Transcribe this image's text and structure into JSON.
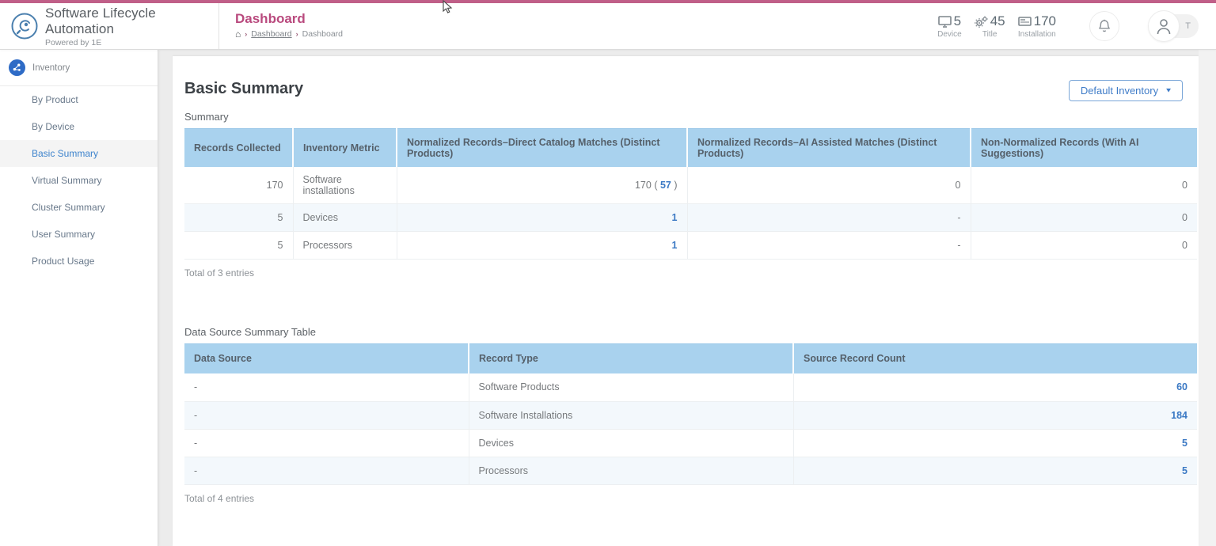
{
  "app": {
    "title": "Software Lifecycle Automation",
    "subtitle": "Powered by 1E"
  },
  "header": {
    "page_title": "Dashboard",
    "breadcrumb": {
      "home": "⌂",
      "crumb1": "Dashboard",
      "crumb2": "Dashboard"
    },
    "stats": [
      {
        "icon": "monitor-icon",
        "value": "5",
        "label": "Device"
      },
      {
        "icon": "gears-icon",
        "value": "45",
        "label": "Title"
      },
      {
        "icon": "installation-icon",
        "value": "170",
        "label": "Installation"
      }
    ],
    "avatar_badge": "T"
  },
  "sidebar": {
    "section_label": "Inventory",
    "items": [
      {
        "label": "By Product"
      },
      {
        "label": "By Device"
      },
      {
        "label": "Basic Summary"
      },
      {
        "label": "Virtual Summary"
      },
      {
        "label": "Cluster Summary"
      },
      {
        "label": "User Summary"
      },
      {
        "label": "Product Usage"
      }
    ]
  },
  "main": {
    "title": "Basic Summary",
    "inventory_selector": "Default Inventory",
    "summary": {
      "label": "Summary",
      "columns": [
        "Records Collected",
        "Inventory Metric",
        "Normalized Records–Direct Catalog Matches (Distinct Products)",
        "Normalized Records–AI Assisted Matches (Distinct Products)",
        "Non-Normalized Records (With AI Suggestions)"
      ],
      "rows": [
        [
          {
            "v": "170",
            "a": "r"
          },
          {
            "v": "Software installations",
            "a": "l"
          },
          {
            "pre": "170 ( ",
            "v": "57",
            "suf": " )",
            "link": true,
            "a": "r"
          },
          {
            "v": "0",
            "a": "r"
          },
          {
            "v": "0",
            "a": "r"
          }
        ],
        [
          {
            "v": "5",
            "a": "r"
          },
          {
            "v": "Devices",
            "a": "l"
          },
          {
            "v": "1",
            "link": true,
            "a": "r"
          },
          {
            "v": "-",
            "a": "r"
          },
          {
            "v": "0",
            "a": "r"
          }
        ],
        [
          {
            "v": "5",
            "a": "r"
          },
          {
            "v": "Processors",
            "a": "l"
          },
          {
            "v": "1",
            "link": true,
            "a": "r"
          },
          {
            "v": "-",
            "a": "r"
          },
          {
            "v": "0",
            "a": "r"
          }
        ]
      ],
      "total": "Total of 3 entries"
    },
    "data_source": {
      "label": "Data Source Summary Table",
      "columns": [
        "Data Source",
        "Record Type",
        "Source Record Count"
      ],
      "rows": [
        [
          {
            "v": "-",
            "a": "l"
          },
          {
            "v": "Software Products",
            "a": "l"
          },
          {
            "v": "60",
            "link": true,
            "a": "r"
          }
        ],
        [
          {
            "v": "-",
            "a": "l"
          },
          {
            "v": "Software Installations",
            "a": "l"
          },
          {
            "v": "184",
            "link": true,
            "a": "r"
          }
        ],
        [
          {
            "v": "-",
            "a": "l"
          },
          {
            "v": "Devices",
            "a": "l"
          },
          {
            "v": "5",
            "link": true,
            "a": "r"
          }
        ],
        [
          {
            "v": "-",
            "a": "l"
          },
          {
            "v": "Processors",
            "a": "l"
          },
          {
            "v": "5",
            "link": true,
            "a": "r"
          }
        ]
      ],
      "total": "Total of 4 entries"
    }
  },
  "colors": {
    "topbar_pink": "#c05f88",
    "title_pink": "#b94a7e",
    "table_header_blue": "#a9d2ee",
    "link_blue": "#3b79c4",
    "active_nav_blue": "#3d83cc"
  }
}
